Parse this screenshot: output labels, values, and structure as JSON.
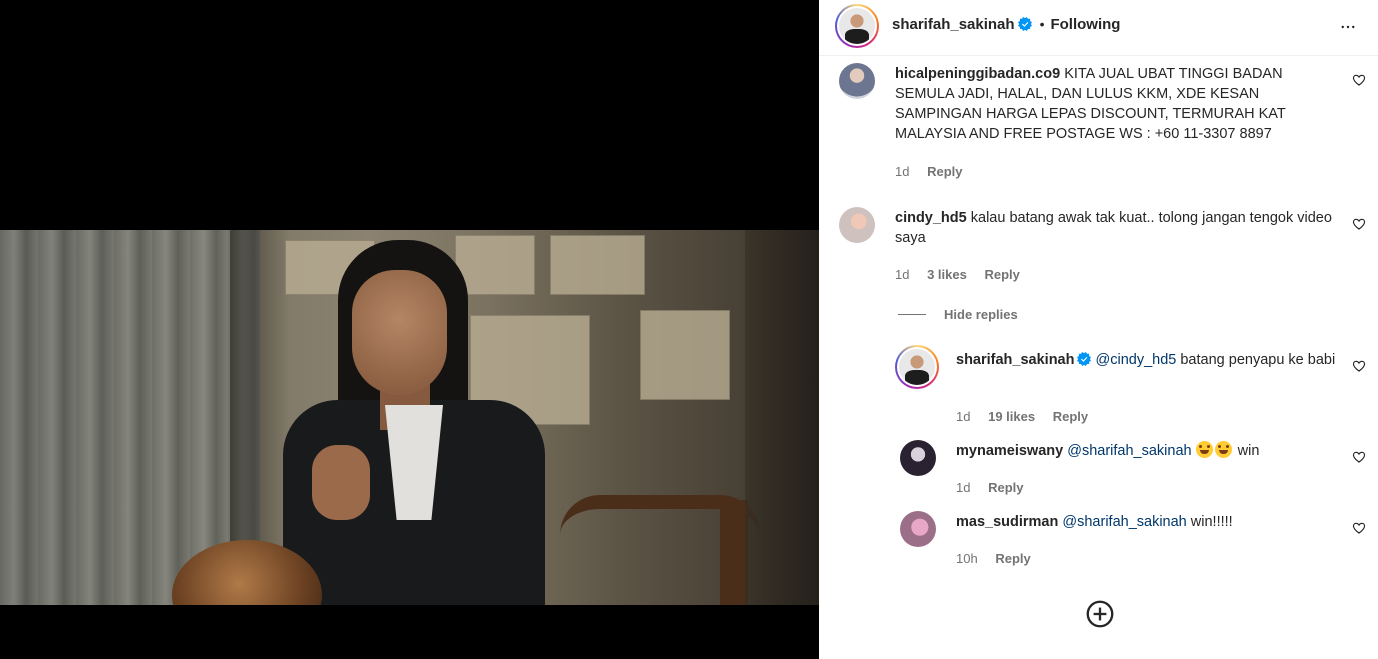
{
  "post": {
    "username": "sharifah_sakinah",
    "follow_status": "Following",
    "separator": "•"
  },
  "comments": [
    {
      "username": "hicalpeninggibadan.co9",
      "text": "KITA JUAL UBAT TINGGI BADAN SEMULA JADI, HALAL, DAN LULUS KKM, XDE KESAN SAMPINGAN HARGA LEPAS DISCOUNT, TERMURAH KAT MALAYSIA AND FREE POSTAGE WS : +60 11-3307 8897",
      "time": "1d",
      "likes": "",
      "reply_label": "Reply"
    },
    {
      "username": "cindy_hd5",
      "text": "kalau batang awak tak kuat.. tolong jangan tengok video saya",
      "time": "1d",
      "likes": "3 likes",
      "reply_label": "Reply",
      "hide_replies_label": "Hide replies",
      "replies": [
        {
          "username": "sharifah_sakinah",
          "mention": "@cindy_hd5",
          "text": " batang penyapu ke babi",
          "time": "1d",
          "likes": "19 likes",
          "reply_label": "Reply"
        },
        {
          "username": "mynameiswany",
          "mention": "@sharifah_sakinah",
          "text": "win",
          "emoji_count": 2,
          "time": "1d",
          "reply_label": "Reply"
        },
        {
          "username": "mas_sudirman",
          "mention": "@sharifah_sakinah",
          "text": " win!!!!!",
          "time": "10h",
          "reply_label": "Reply"
        }
      ]
    }
  ],
  "icons": {
    "verified": "verified-badge-icon",
    "more": "more-options-icon",
    "like": "heart-icon",
    "load_more": "plus-circle-icon"
  },
  "colors": {
    "verified": "#0095f6",
    "mention": "#00376b",
    "secondary_text": "#737373"
  }
}
